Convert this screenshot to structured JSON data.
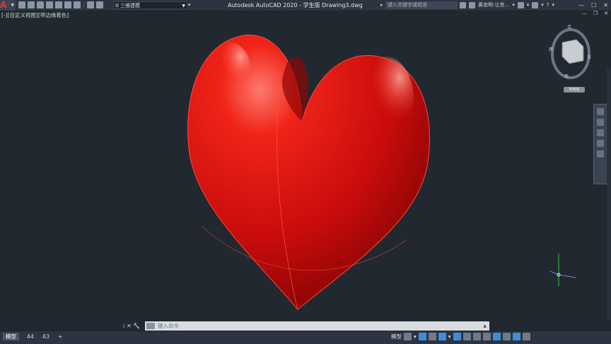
{
  "titlebar": {
    "app_letter": "A",
    "workspace": "三维建模",
    "window_title": "Autodesk AutoCAD 2020 - 学生版    Drawing3.dwg",
    "search_placeholder": "键入关键字或短语",
    "user": "黄忠明-让世...",
    "help_icon": "?"
  },
  "viewport": {
    "label": "[-][自定义视图][带边缘着色]"
  },
  "viewcube": {
    "wcs": "未命名"
  },
  "command": {
    "placeholder": "键入命令"
  },
  "tabs": [
    {
      "label": "模型"
    },
    {
      "label": "A4"
    },
    {
      "label": "A3"
    },
    {
      "label": "+"
    }
  ],
  "status": {
    "model_label": "模型"
  },
  "colors": {
    "background": "#212830",
    "heart": "#d11010",
    "accent": "#3a8fd8"
  }
}
